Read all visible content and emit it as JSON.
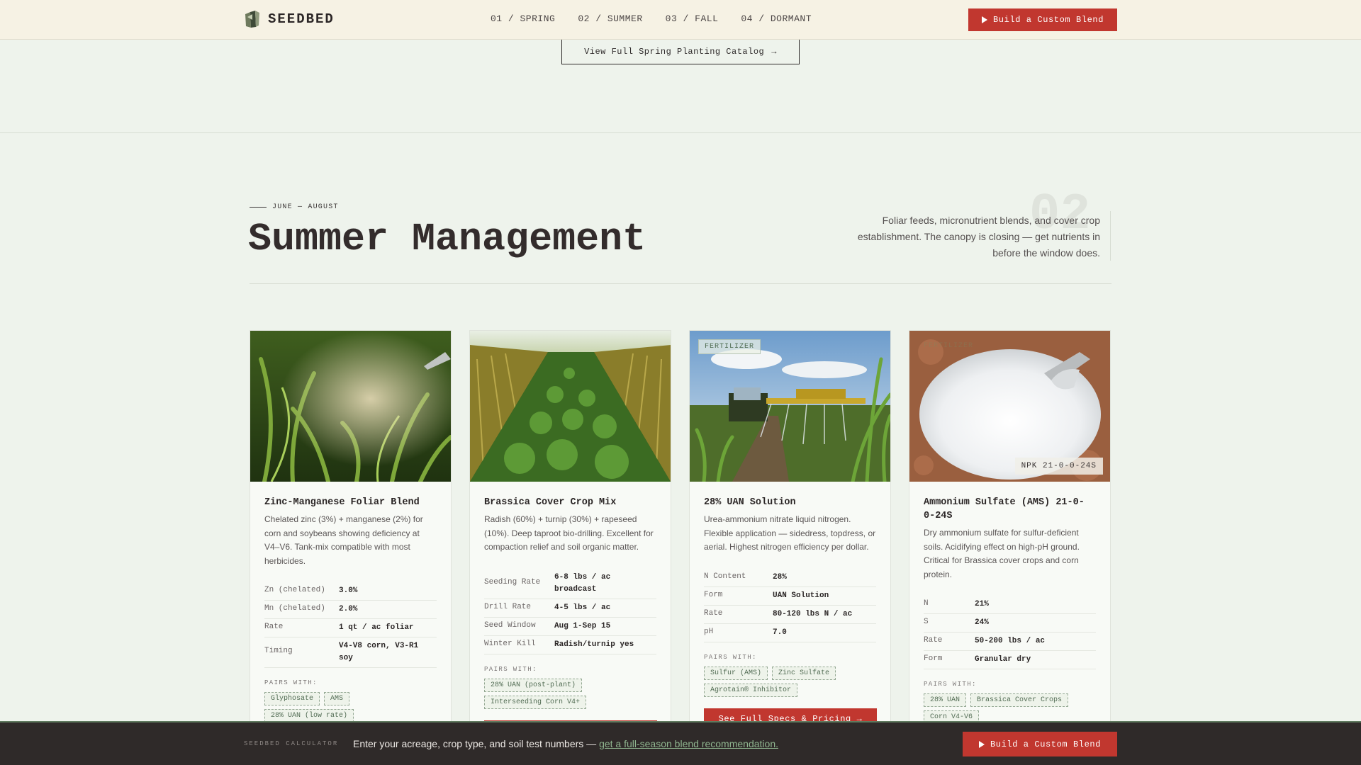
{
  "nav": {
    "brand": "SEEDBED",
    "links": [
      "01 / SPRING",
      "02 / SUMMER",
      "03 / FALL",
      "04 / DORMANT"
    ],
    "cta": "Build a Custom Blend"
  },
  "prev_section": {
    "catalog_button": "View Full Spring Planting Catalog",
    "catalog_arrow": "→"
  },
  "season": {
    "eyebrow": "JUNE — AUGUST",
    "title": "Summer Management",
    "number": "02",
    "description": "Foliar feeds, micronutrient blends, and cover crop establishment. The canopy is closing — get nutrients in before the window does."
  },
  "cards": [
    {
      "title": "Zinc-Manganese Foliar Blend",
      "description": "Chelated zinc (3%) + manganese (2%) for corn and soybeans showing deficiency at V4–V6. Tank-mix compatible with most herbicides.",
      "specs": [
        {
          "k": "Zn (chelated)",
          "v": "3.0%"
        },
        {
          "k": "Mn (chelated)",
          "v": "2.0%"
        },
        {
          "k": "Rate",
          "v": "1 qt / ac foliar"
        },
        {
          "k": "Timing",
          "v": "V4-V8 corn, V3-R1 soy"
        }
      ],
      "pairs_label": "PAIRS WITH:",
      "pairs": [
        "Glyphosate",
        "AMS",
        "28% UAN (low rate)"
      ]
    },
    {
      "title": "Brassica Cover Crop Mix",
      "description": "Radish (60%) + turnip (30%) + rapeseed (10%). Deep taproot bio-drilling. Excellent for compaction relief and soil organic matter.",
      "specs": [
        {
          "k": "Seeding Rate",
          "v": "6-8 lbs / ac broadcast"
        },
        {
          "k": "Drill Rate",
          "v": "4-5 lbs / ac"
        },
        {
          "k": "Seed Window",
          "v": "Aug 1-Sep 15"
        },
        {
          "k": "Winter Kill",
          "v": "Radish/turnip yes"
        }
      ],
      "pairs_label": "PAIRS WITH:",
      "pairs": [
        "28% UAN (post-plant)",
        "Interseeding Corn V4+"
      ]
    },
    {
      "tag": "FERTILIZER",
      "title": "28% UAN Solution",
      "description": "Urea-ammonium nitrate liquid nitrogen. Flexible application — sidedress, topdress, or aerial. Highest nitrogen efficiency per dollar.",
      "specs": [
        {
          "k": "N Content",
          "v": "28%"
        },
        {
          "k": "Form",
          "v": "UAN Solution"
        },
        {
          "k": "Rate",
          "v": "80-120 lbs N / ac"
        },
        {
          "k": "pH",
          "v": "7.0"
        }
      ],
      "pairs_label": "PAIRS WITH:",
      "pairs": [
        "Sulfur (AMS)",
        "Zinc Sulfate",
        "Agrotain® Inhibitor"
      ],
      "cta": "See Full Specs & Pricing →"
    },
    {
      "tag": "FERTILIZER",
      "npk": "NPK 21-0-0-24S",
      "title": "Ammonium Sulfate (AMS) 21-0-0-24S",
      "description": "Dry ammonium sulfate for sulfur-deficient soils. Acidifying effect on high-pH ground. Critical for Brassica cover crops and corn protein.",
      "specs": [
        {
          "k": "N",
          "v": "21%"
        },
        {
          "k": "S",
          "v": "24%"
        },
        {
          "k": "Rate",
          "v": "50-200 lbs / ac"
        },
        {
          "k": "Form",
          "v": "Granular dry"
        }
      ],
      "pairs_label": "PAIRS WITH:",
      "pairs": [
        "28% UAN",
        "Brassica Cover Crops",
        "Corn V4-V6"
      ]
    }
  ],
  "bottom_bar": {
    "label": "SEEDBED CALCULATOR",
    "text": "Enter your acreage, crop type, and soil test numbers —",
    "link": "get a full-season blend recommendation.",
    "cta": "Build a Custom Blend"
  },
  "colors": {
    "accent_red": "#c1372f",
    "page_bg": "#eef3ec",
    "nav_bg": "#f6f2e4",
    "bottom_bg": "#2f2a29",
    "chip_green": "#526c54"
  }
}
